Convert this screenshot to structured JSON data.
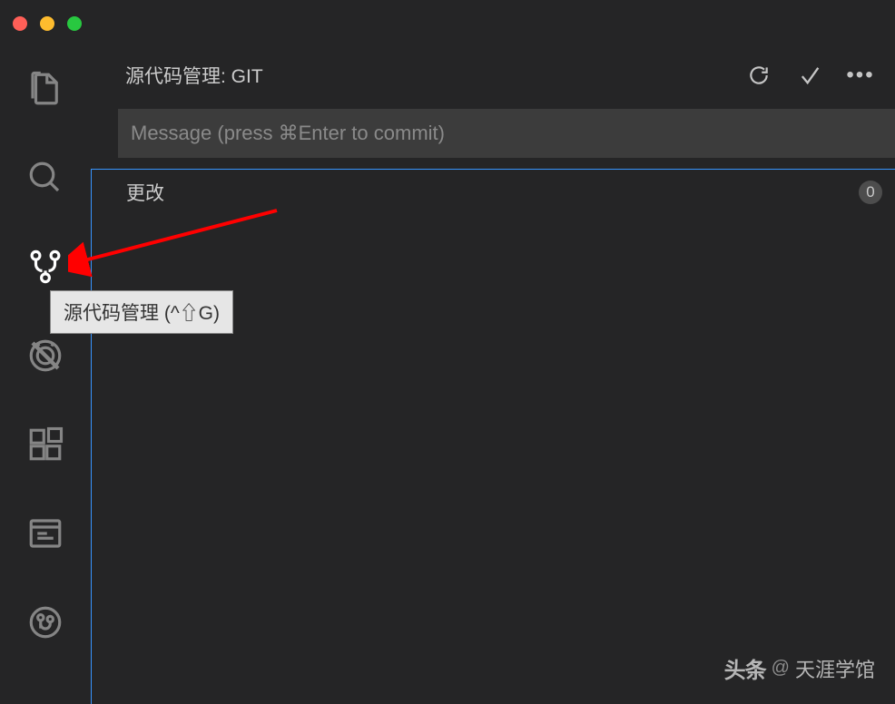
{
  "panel": {
    "title": "源代码管理: GIT",
    "message_placeholder": "Message (press ⌘Enter to commit)"
  },
  "changes": {
    "label": "更改",
    "count": "0"
  },
  "tooltip": {
    "text": "源代码管理 (^⇧G)"
  },
  "watermark": {
    "brand": "头条",
    "at": "@",
    "name": "天涯学馆"
  }
}
